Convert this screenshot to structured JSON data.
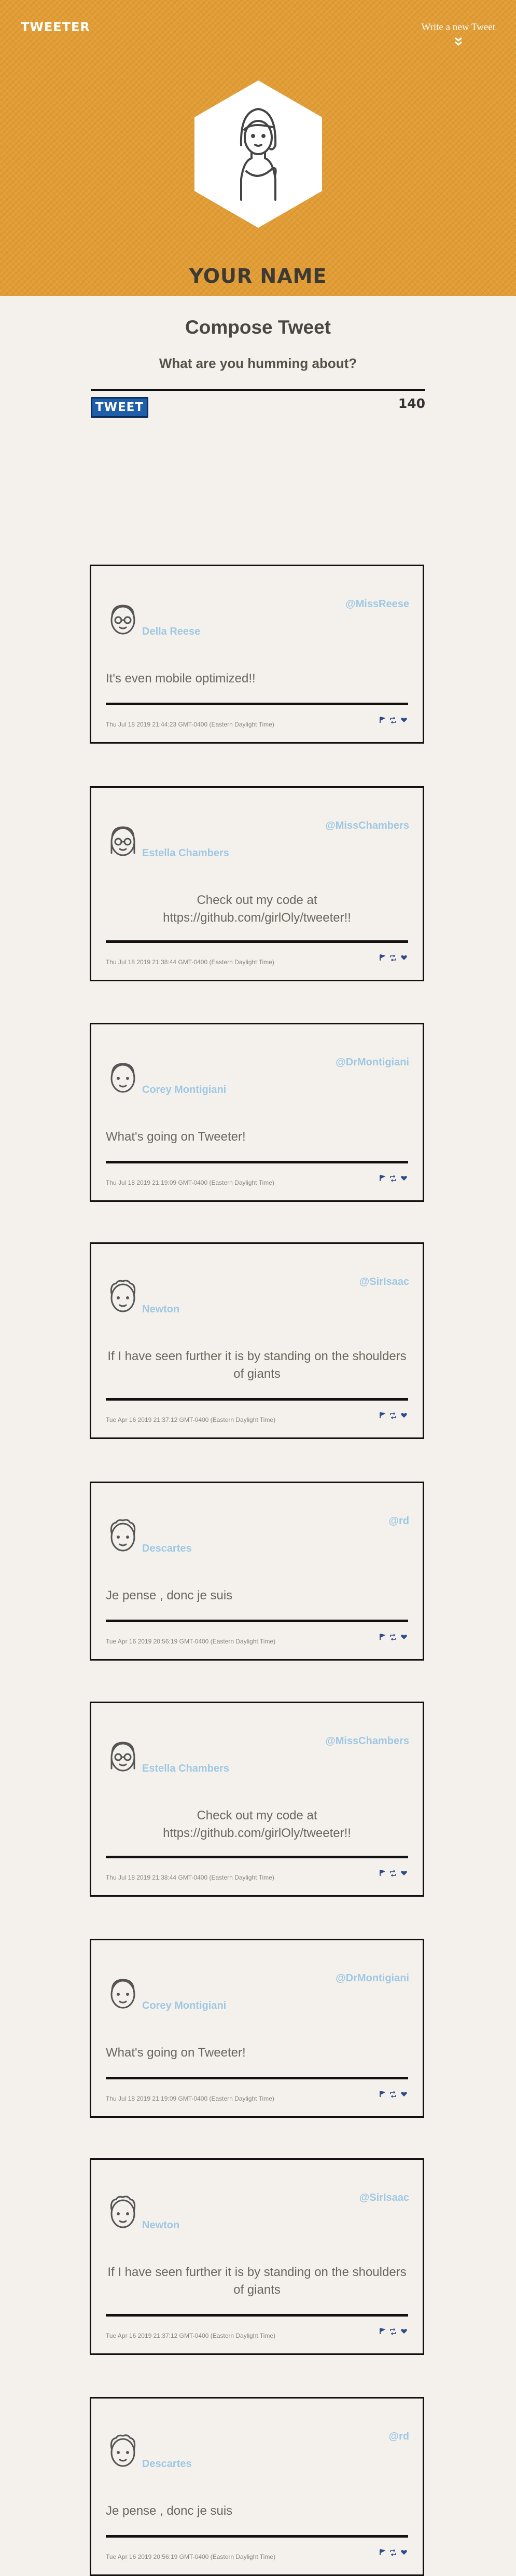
{
  "header": {
    "logo": "TWEETER",
    "write_new": "Write a new Tweet",
    "your_name": "YOUR NAME"
  },
  "compose": {
    "title": "Compose Tweet",
    "prompt": "What are you humming about?",
    "button": "TWEET",
    "counter": "140"
  },
  "colors": {
    "header_bg": "#e29d35",
    "page_bg": "#f4f1ec",
    "handle": "#9ec8e4",
    "button": "#1f5ea8"
  },
  "tweets": [
    {
      "name": "Della Reese",
      "handle": "@MissReese",
      "text": "It's even mobile optimized!!",
      "date": "Thu Jul 18 2019 21:44:23 GMT-0400 (Eastern Daylight Time)"
    },
    {
      "name": "Estella Chambers",
      "handle": "@MissChambers",
      "text": "Check out my code at https://github.com/girlOly/tweeter!!",
      "date": "Thu Jul 18 2019 21:38:44 GMT-0400 (Eastern Daylight Time)"
    },
    {
      "name": "Corey Montigiani",
      "handle": "@DrMontigiani",
      "text": "What's going on Tweeter!",
      "date": "Thu Jul 18 2019 21:19:09 GMT-0400 (Eastern Daylight Time)"
    },
    {
      "name": "Newton",
      "handle": "@SirIsaac",
      "text": "If I have seen further it is by standing on the shoulders of giants",
      "date": "Tue Apr 16 2019 21:37:12 GMT-0400 (Eastern Daylight Time)"
    },
    {
      "name": "Descartes",
      "handle": "@rd",
      "text": "Je pense , donc je suis",
      "date": "Tue Apr 16 2019 20:56:19 GMT-0400 (Eastern Daylight Time)"
    },
    {
      "name": "Estella Chambers",
      "handle": "@MissChambers",
      "text": "Check out my code at https://github.com/girlOly/tweeter!!",
      "date": "Thu Jul 18 2019 21:38:44 GMT-0400 (Eastern Daylight Time)"
    },
    {
      "name": "Corey Montigiani",
      "handle": "@DrMontigiani",
      "text": "What's going on Tweeter!",
      "date": "Thu Jul 18 2019 21:19:09 GMT-0400 (Eastern Daylight Time)"
    },
    {
      "name": "Newton",
      "handle": "@SirIsaac",
      "text": "If I have seen further it is by standing on the shoulders of giants",
      "date": "Tue Apr 16 2019 21:37:12 GMT-0400 (Eastern Daylight Time)"
    },
    {
      "name": "Descartes",
      "handle": "@rd",
      "text": "Je pense , donc je suis",
      "date": "Tue Apr 16 2019 20:56:19 GMT-0400 (Eastern Daylight Time)"
    }
  ]
}
